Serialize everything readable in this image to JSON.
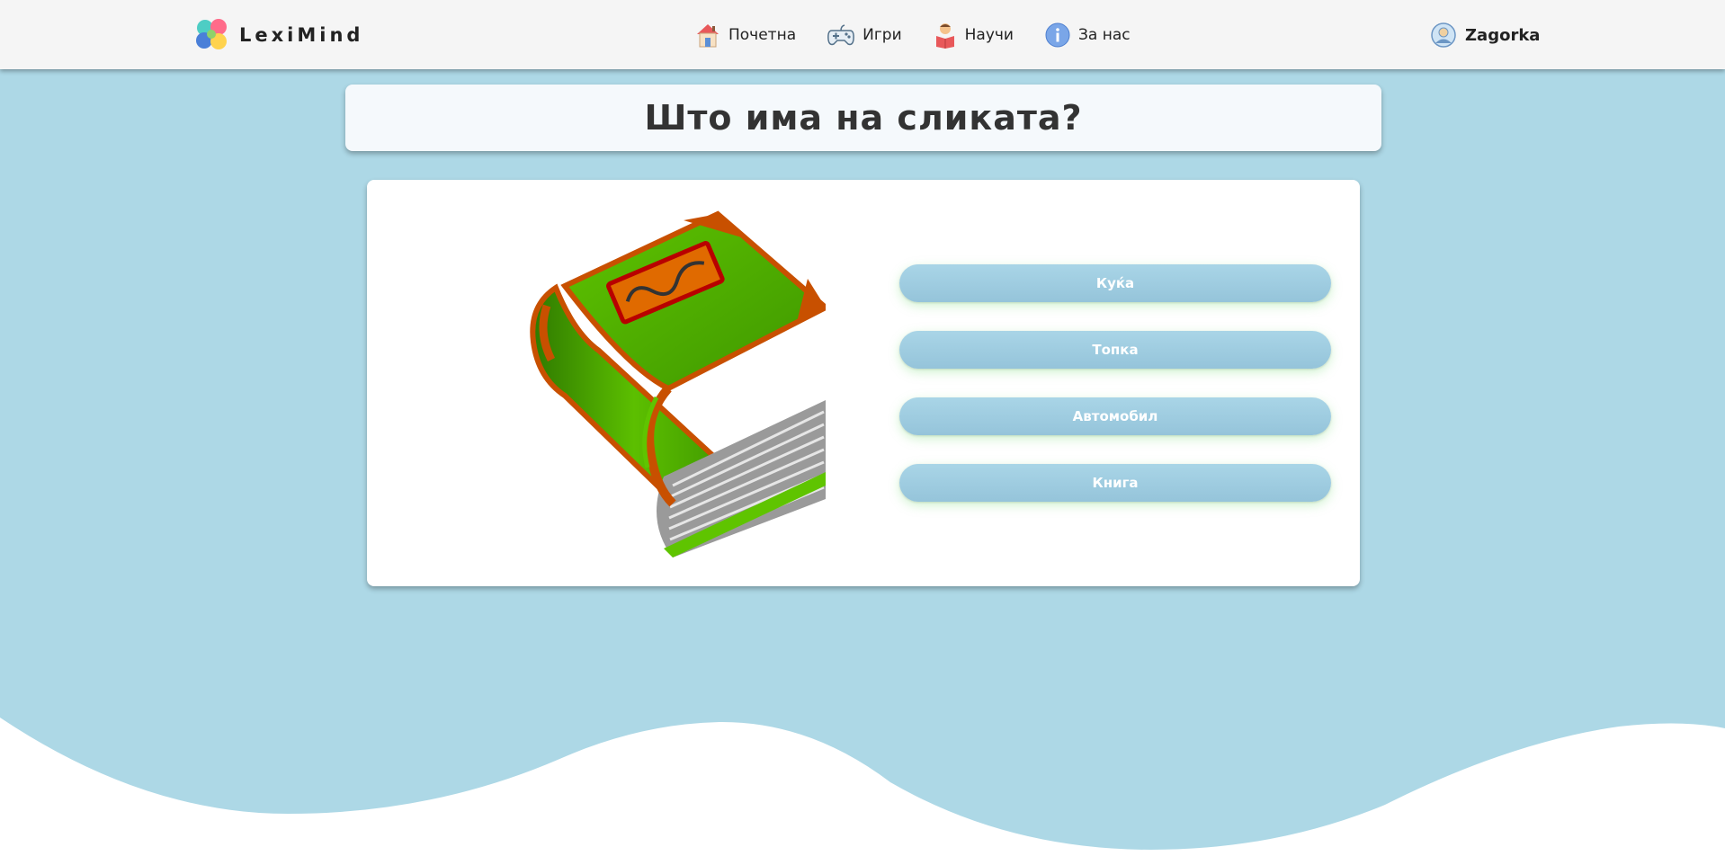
{
  "brand": {
    "name": "LexiMind"
  },
  "nav": {
    "items": [
      {
        "label": "Почетна",
        "icon": "home-icon"
      },
      {
        "label": "Игри",
        "icon": "gamepad-icon"
      },
      {
        "label": "Научи",
        "icon": "reading-icon"
      },
      {
        "label": "За нас",
        "icon": "info-icon"
      }
    ]
  },
  "user": {
    "name": "Zagorka",
    "icon": "user-avatar-icon"
  },
  "quiz": {
    "question": "Што има на сликата?",
    "image": "book-icon",
    "options": [
      "Куќа",
      "Топка",
      "Автомобил",
      "Книга"
    ]
  },
  "colors": {
    "background": "#add8e6",
    "navbar": "#f5f5f5",
    "answer_button": "#a0cde0",
    "book_green": "#4caf00",
    "book_orange": "#c85000"
  }
}
